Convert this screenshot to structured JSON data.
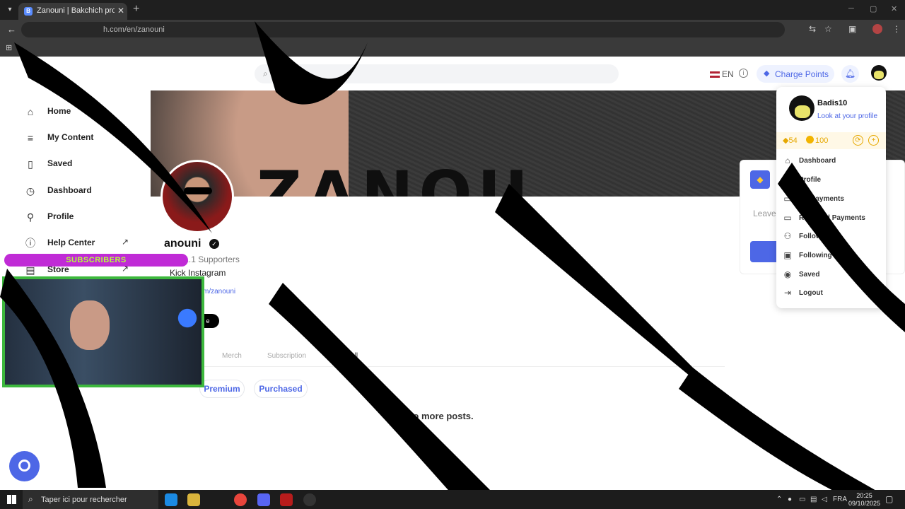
{
  "browser": {
    "tab_title": "Zanouni | Bakchich profile | Bak",
    "tab_favicon": "B",
    "url": "h.com/en/zanouni",
    "icons": [
      "tab-menu-icon",
      "close-icon",
      "new-tab-icon",
      "back-arrow-icon",
      "translate-icon",
      "star-icon",
      "extensions-icon",
      "kebab-icon"
    ]
  },
  "header": {
    "search_placeholder": "Search",
    "language": "EN",
    "charge_label": "Charge Points"
  },
  "sidebar": {
    "items": [
      {
        "label": "Home",
        "icon": "home-icon"
      },
      {
        "label": "My Content",
        "icon": "list-icon"
      },
      {
        "label": "Saved",
        "icon": "bookmark-icon"
      },
      {
        "label": "Dashboard",
        "icon": "dashboard-icon"
      },
      {
        "label": "Profile",
        "icon": "user-icon"
      },
      {
        "label": "Help Center",
        "icon": "info-icon"
      },
      {
        "label": "Store",
        "icon": "store-icon"
      }
    ]
  },
  "profile": {
    "cover_text": "ZANOU",
    "name": "anouni",
    "meta": "ni • 1.1 Supporters",
    "socials": "Kick  Instagram",
    "link": "m/zanouni",
    "follow_label": "e",
    "tabs": [
      "Merch",
      "Subscription",
      "Fan Wall"
    ],
    "filters": [
      "Premium",
      "Purchased"
    ],
    "empty_message": "No more posts."
  },
  "right_card": {
    "leave_text": "Leave"
  },
  "dropdown": {
    "username": "Badis10",
    "subtitle": "Look at your profile",
    "gems": "54",
    "coins": "100",
    "items": [
      {
        "label": "Dashboard",
        "icon": "home-icon"
      },
      {
        "label": "Profile",
        "icon": "user-icon"
      },
      {
        "label": "My Payments",
        "icon": "card-icon"
      },
      {
        "label": "Received Payments",
        "icon": "card-icon"
      },
      {
        "label": "Followers",
        "icon": "users-icon"
      },
      {
        "label": "Following",
        "icon": "contact-icon"
      },
      {
        "label": "Saved",
        "icon": "eye-icon"
      },
      {
        "label": "Logout",
        "icon": "logout-icon"
      }
    ]
  },
  "stream_overlay": {
    "banner": "SUBSCRIBERS"
  },
  "taskbar": {
    "search_text": "Taper ici pour rechercher",
    "language": "FRA",
    "time": "20:25",
    "date": "09/10/2025"
  },
  "colors": {
    "accent": "#4d67e6",
    "banner_bg": "#c02bd6",
    "banner_text": "#b4ff3a",
    "webcam_border": "#3db83d"
  }
}
